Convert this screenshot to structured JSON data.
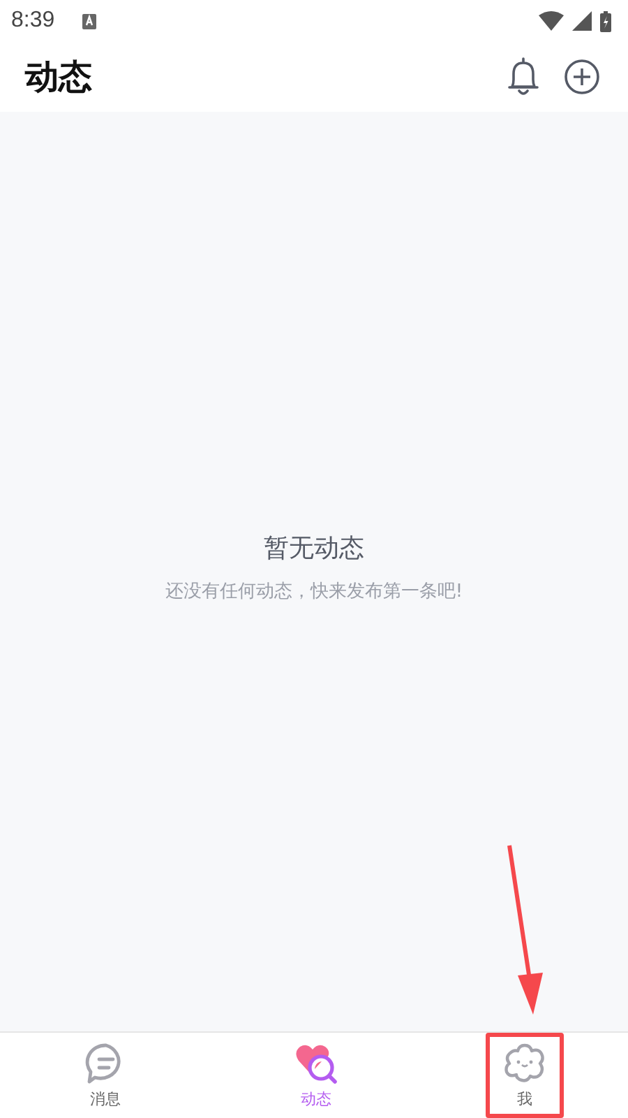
{
  "status_bar": {
    "time": "8:39"
  },
  "header": {
    "title": "动态"
  },
  "empty_state": {
    "title": "暂无动态",
    "subtitle": "还没有任何动态，快来发布第一条吧!"
  },
  "tabs": [
    {
      "kind": "chat",
      "label": "消息",
      "selected": false,
      "highlighted": false
    },
    {
      "kind": "feed",
      "label": "动态",
      "selected": true,
      "highlighted": false
    },
    {
      "kind": "profile",
      "label": "我",
      "selected": false,
      "highlighted": true
    }
  ]
}
